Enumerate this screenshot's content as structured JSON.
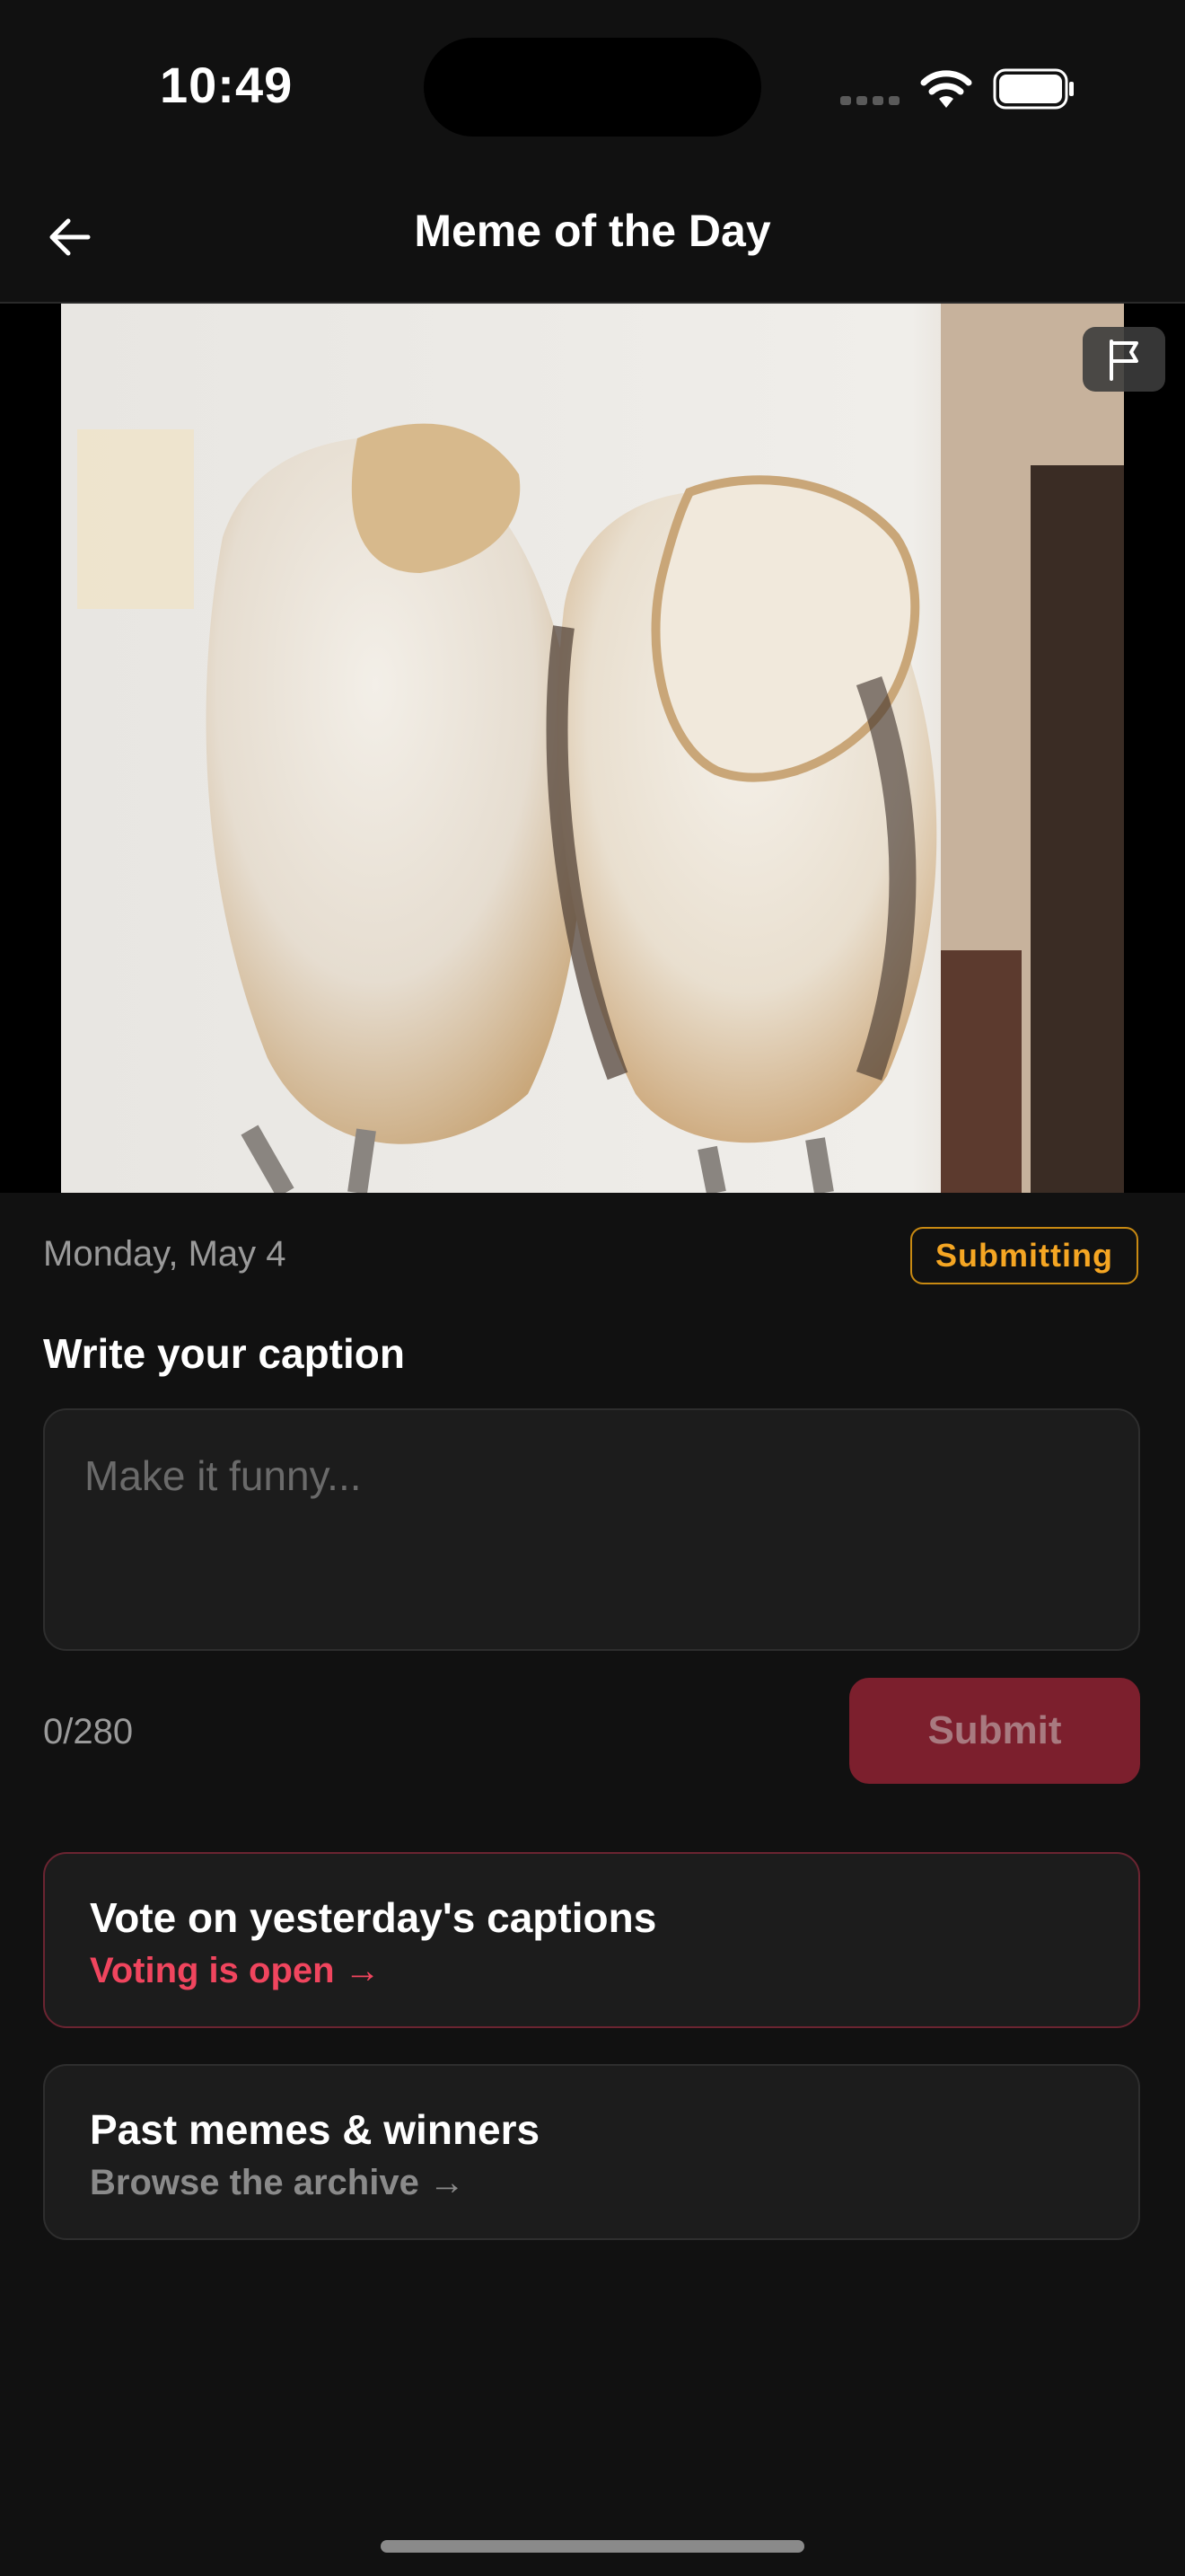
{
  "status_bar": {
    "time": "10:49"
  },
  "nav": {
    "title": "Meme of the Day"
  },
  "meme": {
    "alt": "Two barn owls"
  },
  "meta": {
    "date": "Monday, May 4",
    "status_badge": "Submitting"
  },
  "caption": {
    "heading": "Write your caption",
    "placeholder": "Make it funny...",
    "counter": "0/280",
    "submit_label": "Submit"
  },
  "cards": {
    "vote": {
      "title": "Vote on yesterday's captions",
      "subtitle": "Voting is open →"
    },
    "past": {
      "title": "Past memes & winners",
      "subtitle": "Browse the archive →"
    }
  },
  "colors": {
    "background": "#111111",
    "accent": "#f0455e",
    "badge": "#f5a623",
    "submit_disabled": "#7c1f2d"
  }
}
